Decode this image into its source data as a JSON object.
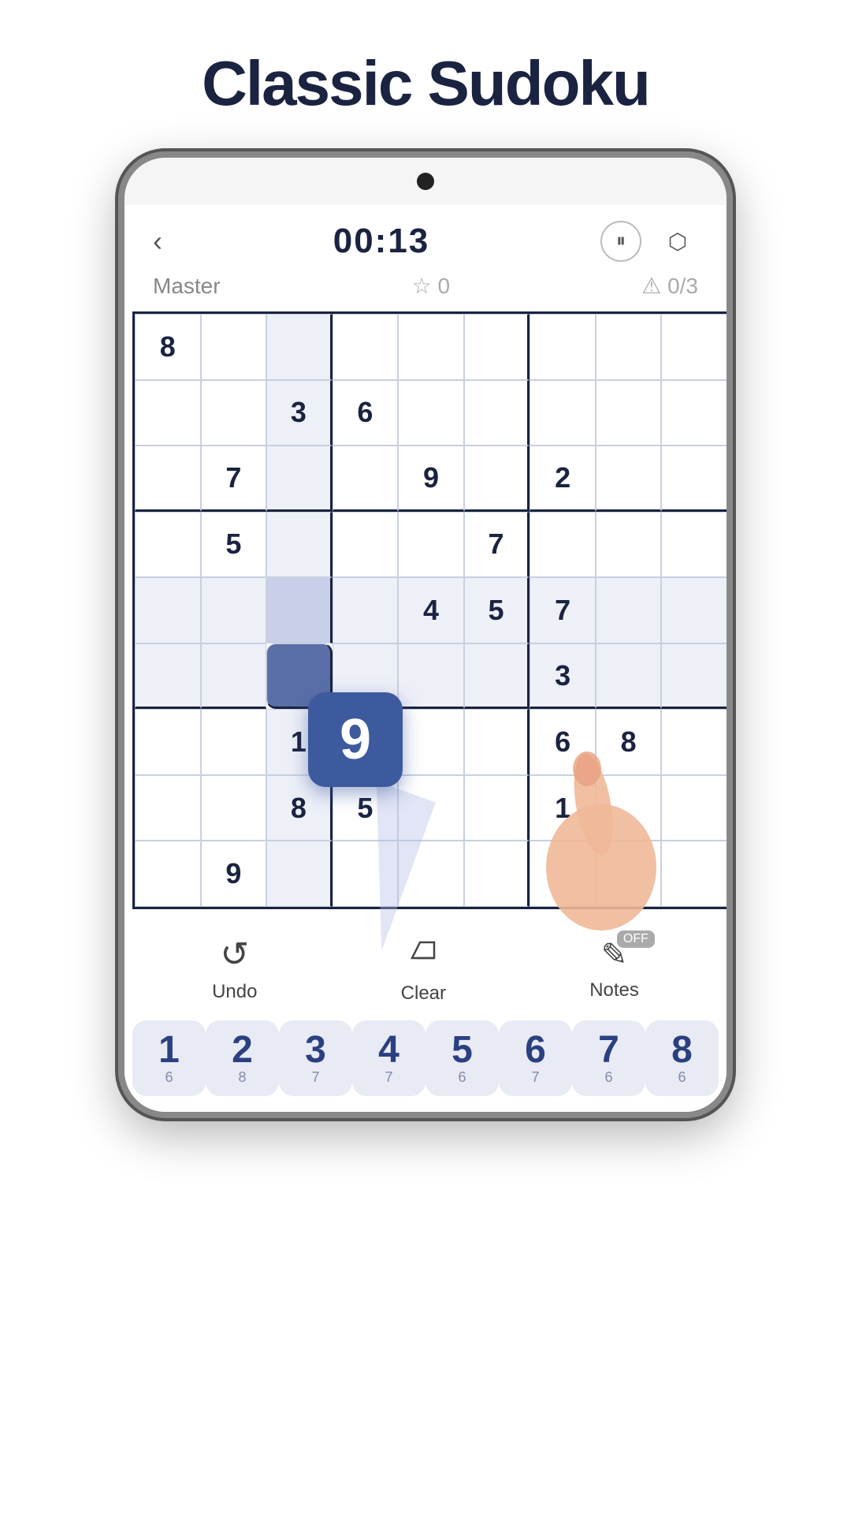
{
  "page": {
    "title": "Classic Sudoku"
  },
  "header": {
    "back_label": "‹",
    "timer": "00:13",
    "pause_icon": "pause-icon",
    "settings_icon": "settings-icon",
    "difficulty": "Master",
    "star_score": "☆ 0",
    "mistakes": "⚠ 0/3"
  },
  "board": {
    "cells": [
      {
        "row": 0,
        "col": 0,
        "value": "8",
        "given": true
      },
      {
        "row": 0,
        "col": 1,
        "value": "",
        "given": false
      },
      {
        "row": 0,
        "col": 2,
        "value": "",
        "given": false,
        "highlight": true
      },
      {
        "row": 0,
        "col": 3,
        "value": "",
        "given": false
      },
      {
        "row": 0,
        "col": 4,
        "value": "",
        "given": false
      },
      {
        "row": 0,
        "col": 5,
        "value": "",
        "given": false
      },
      {
        "row": 0,
        "col": 6,
        "value": "",
        "given": false
      },
      {
        "row": 0,
        "col": 7,
        "value": "",
        "given": false
      },
      {
        "row": 0,
        "col": 8,
        "value": "",
        "given": false
      },
      {
        "row": 1,
        "col": 0,
        "value": "",
        "given": false
      },
      {
        "row": 1,
        "col": 1,
        "value": "",
        "given": false
      },
      {
        "row": 1,
        "col": 2,
        "value": "3",
        "given": true
      },
      {
        "row": 1,
        "col": 3,
        "value": "6",
        "given": true
      },
      {
        "row": 1,
        "col": 4,
        "value": "",
        "given": false
      },
      {
        "row": 1,
        "col": 5,
        "value": "",
        "given": false
      },
      {
        "row": 1,
        "col": 6,
        "value": "",
        "given": false
      },
      {
        "row": 1,
        "col": 7,
        "value": "",
        "given": false
      },
      {
        "row": 1,
        "col": 8,
        "value": "",
        "given": false
      },
      {
        "row": 2,
        "col": 0,
        "value": "",
        "given": false
      },
      {
        "row": 2,
        "col": 1,
        "value": "7",
        "given": true
      },
      {
        "row": 2,
        "col": 2,
        "value": "",
        "given": false
      },
      {
        "row": 2,
        "col": 3,
        "value": "",
        "given": false
      },
      {
        "row": 2,
        "col": 4,
        "value": "9",
        "given": true
      },
      {
        "row": 2,
        "col": 5,
        "value": "",
        "given": false
      },
      {
        "row": 2,
        "col": 6,
        "value": "2",
        "given": true
      },
      {
        "row": 2,
        "col": 7,
        "value": "",
        "given": false
      },
      {
        "row": 2,
        "col": 8,
        "value": "",
        "given": false
      },
      {
        "row": 3,
        "col": 0,
        "value": "",
        "given": false
      },
      {
        "row": 3,
        "col": 1,
        "value": "5",
        "given": true
      },
      {
        "row": 3,
        "col": 2,
        "value": "",
        "given": false
      },
      {
        "row": 3,
        "col": 3,
        "value": "",
        "given": false
      },
      {
        "row": 3,
        "col": 4,
        "value": "",
        "given": false
      },
      {
        "row": 3,
        "col": 5,
        "value": "7",
        "given": true
      },
      {
        "row": 3,
        "col": 6,
        "value": "",
        "given": false
      },
      {
        "row": 3,
        "col": 7,
        "value": "",
        "given": false
      },
      {
        "row": 3,
        "col": 8,
        "value": "",
        "given": false
      },
      {
        "row": 4,
        "col": 0,
        "value": "",
        "given": false
      },
      {
        "row": 4,
        "col": 1,
        "value": "",
        "given": false
      },
      {
        "row": 4,
        "col": 2,
        "value": "",
        "given": false,
        "selected": true
      },
      {
        "row": 4,
        "col": 3,
        "value": "",
        "given": false
      },
      {
        "row": 4,
        "col": 4,
        "value": "4",
        "given": true
      },
      {
        "row": 4,
        "col": 5,
        "value": "5",
        "given": true
      },
      {
        "row": 4,
        "col": 6,
        "value": "7",
        "given": true
      },
      {
        "row": 4,
        "col": 7,
        "value": "",
        "given": false
      },
      {
        "row": 4,
        "col": 8,
        "value": "",
        "given": false
      },
      {
        "row": 5,
        "col": 0,
        "value": "",
        "given": false
      },
      {
        "row": 5,
        "col": 1,
        "value": "",
        "given": false
      },
      {
        "row": 5,
        "col": 2,
        "value": "",
        "given": false,
        "active": true
      },
      {
        "row": 5,
        "col": 3,
        "value": "",
        "given": false
      },
      {
        "row": 5,
        "col": 4,
        "value": "",
        "given": false
      },
      {
        "row": 5,
        "col": 5,
        "value": "",
        "given": false
      },
      {
        "row": 5,
        "col": 6,
        "value": "3",
        "given": true
      },
      {
        "row": 5,
        "col": 7,
        "value": "",
        "given": false
      },
      {
        "row": 5,
        "col": 8,
        "value": "",
        "given": false
      },
      {
        "row": 6,
        "col": 0,
        "value": "",
        "given": false
      },
      {
        "row": 6,
        "col": 1,
        "value": "",
        "given": false
      },
      {
        "row": 6,
        "col": 2,
        "value": "1",
        "given": true
      },
      {
        "row": 6,
        "col": 3,
        "value": "",
        "given": false
      },
      {
        "row": 6,
        "col": 4,
        "value": "",
        "given": false
      },
      {
        "row": 6,
        "col": 5,
        "value": "",
        "given": false
      },
      {
        "row": 6,
        "col": 6,
        "value": "6",
        "given": true
      },
      {
        "row": 6,
        "col": 7,
        "value": "8",
        "given": true
      },
      {
        "row": 6,
        "col": 8,
        "value": "",
        "given": false
      },
      {
        "row": 7,
        "col": 0,
        "value": "",
        "given": false
      },
      {
        "row": 7,
        "col": 1,
        "value": "",
        "given": false
      },
      {
        "row": 7,
        "col": 2,
        "value": "8",
        "given": true
      },
      {
        "row": 7,
        "col": 3,
        "value": "5",
        "given": true
      },
      {
        "row": 7,
        "col": 4,
        "value": "",
        "given": false
      },
      {
        "row": 7,
        "col": 5,
        "value": "",
        "given": false
      },
      {
        "row": 7,
        "col": 6,
        "value": "1",
        "given": true
      },
      {
        "row": 7,
        "col": 7,
        "value": "",
        "given": false
      },
      {
        "row": 7,
        "col": 8,
        "value": "",
        "given": false
      },
      {
        "row": 8,
        "col": 0,
        "value": "",
        "given": false
      },
      {
        "row": 8,
        "col": 1,
        "value": "9",
        "given": true
      },
      {
        "row": 8,
        "col": 2,
        "value": "",
        "given": false
      },
      {
        "row": 8,
        "col": 3,
        "value": "",
        "given": false
      },
      {
        "row": 8,
        "col": 4,
        "value": "",
        "given": false
      },
      {
        "row": 8,
        "col": 5,
        "value": "",
        "given": false
      },
      {
        "row": 8,
        "col": 6,
        "value": "",
        "given": false
      },
      {
        "row": 8,
        "col": 7,
        "value": "",
        "given": false
      },
      {
        "row": 8,
        "col": 8,
        "value": "",
        "given": false
      }
    ]
  },
  "controls": {
    "undo_label": "Undo",
    "undo_icon": "↺",
    "clear_label": "Clear",
    "clear_icon": "◇",
    "notes_label": "Notes",
    "notes_icon": "✎",
    "notes_off": "OFF"
  },
  "numpad": [
    {
      "digit": "1",
      "count": "6"
    },
    {
      "digit": "2",
      "count": "8"
    },
    {
      "digit": "3",
      "count": "7"
    },
    {
      "digit": "4",
      "count": "7"
    },
    {
      "digit": "5",
      "count": "6"
    },
    {
      "digit": "6",
      "count": "7"
    },
    {
      "digit": "7",
      "count": "6"
    },
    {
      "digit": "8",
      "count": "6"
    }
  ],
  "floating_nine": "9"
}
